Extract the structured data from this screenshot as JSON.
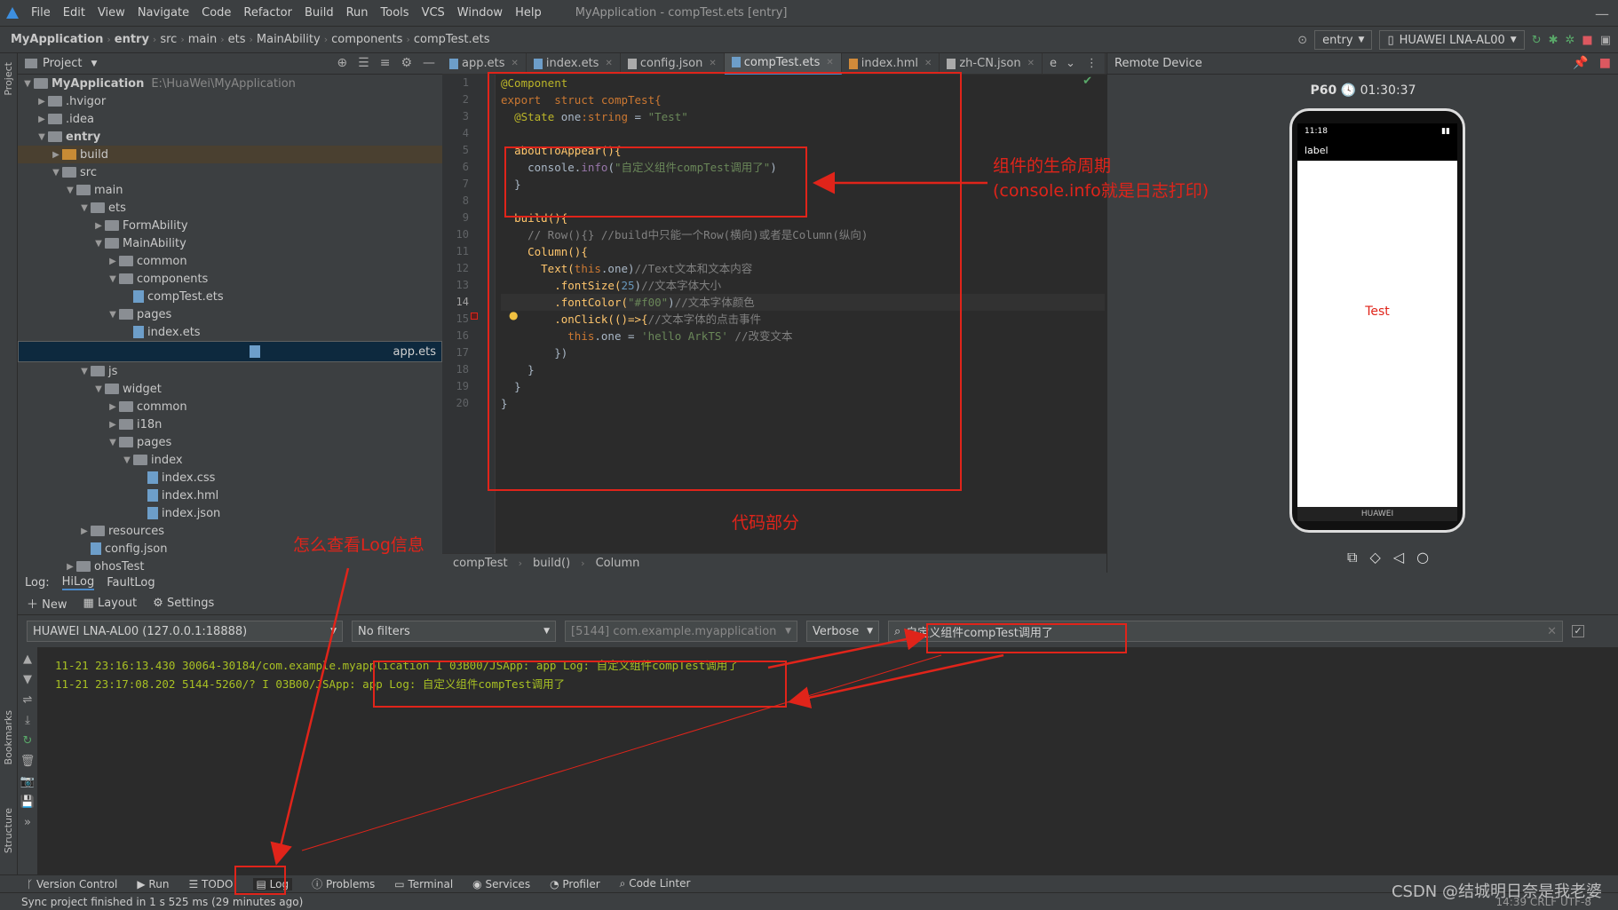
{
  "menubar": {
    "items": [
      "File",
      "Edit",
      "View",
      "Navigate",
      "Code",
      "Refactor",
      "Build",
      "Run",
      "Tools",
      "VCS",
      "Window",
      "Help"
    ],
    "title": "MyApplication - compTest.ets [entry]"
  },
  "navbar": {
    "crumbs": [
      "MyApplication",
      "entry",
      "src",
      "main",
      "ets",
      "MainAbility",
      "components",
      "compTest.ets"
    ],
    "module_combo": "entry",
    "device_combo": "HUAWEI LNA-AL00"
  },
  "project": {
    "header": "Project",
    "root_name": "MyApplication",
    "root_path": "E:\\HuaWei\\MyApplication",
    "tree": [
      {
        "label": ".hvigor",
        "d": 1
      },
      {
        "label": ".idea",
        "d": 1
      },
      {
        "label": "entry",
        "d": 1
      },
      {
        "label": "build",
        "d": 2
      },
      {
        "label": "src",
        "d": 2
      },
      {
        "label": "main",
        "d": 3
      },
      {
        "label": "ets",
        "d": 4
      },
      {
        "label": "FormAbility",
        "d": 5
      },
      {
        "label": "MainAbility",
        "d": 5
      },
      {
        "label": "common",
        "d": 6
      },
      {
        "label": "components",
        "d": 6
      },
      {
        "label": "compTest.ets",
        "d": 7
      },
      {
        "label": "pages",
        "d": 6
      },
      {
        "label": "index.ets",
        "d": 7
      },
      {
        "label": "app.ets",
        "d": 6
      },
      {
        "label": "js",
        "d": 4
      },
      {
        "label": "widget",
        "d": 5
      },
      {
        "label": "common",
        "d": 6
      },
      {
        "label": "i18n",
        "d": 6
      },
      {
        "label": "pages",
        "d": 6
      },
      {
        "label": "index",
        "d": 7
      },
      {
        "label": "index.css",
        "d": 8
      },
      {
        "label": "index.hml",
        "d": 8
      },
      {
        "label": "index.json",
        "d": 8
      },
      {
        "label": "resources",
        "d": 4
      },
      {
        "label": "config.json",
        "d": 4
      },
      {
        "label": "ohosTest",
        "d": 3
      }
    ]
  },
  "editor": {
    "tabs": [
      "app.ets",
      "index.ets",
      "config.json",
      "compTest.ets",
      "index.hml",
      "zh-CN.json",
      "e"
    ],
    "active_tab": "compTest.ets",
    "line_numbers": [
      "1",
      "2",
      "3",
      "4",
      "5",
      "6",
      "7",
      "8",
      "9",
      "10",
      "11",
      "12",
      "13",
      "14",
      "15",
      "16",
      "17",
      "18",
      "19",
      "20"
    ],
    "code": {
      "l1": "@Component",
      "l2a": "export",
      "l2b": "struct",
      "l2c": "compTest{",
      "l3a": "@State",
      "l3b": "one",
      "l3c": ":string",
      "l3d": " = ",
      "l3e": "\"Test\"",
      "l5": "aboutToAppear(){",
      "l6a": "console.",
      "l6b": "info",
      "l6c": "(",
      "l6d": "\"自定义组件compTest调用了\"",
      "l6e": ")",
      "l7": "}",
      "l9": "build(){",
      "l10": "// Row(){} //build中只能一个Row(横向)或者是Column(纵向)",
      "l11": "Column(){",
      "l12a": "Text(",
      "l12b": "this",
      "l12c": ".one)",
      "l12d": "//Text文本和文本内容",
      "l13a": ".fontSize(",
      "l13b": "25",
      "l13c": ")",
      "l13d": "//文本字体大小",
      "l14a": ".fontColor(",
      "l14b": "\"#f00\"",
      "l14c": ")",
      "l14d": "//文本字体颜色",
      "l15a": ".onClick(()=>{",
      "l15b": "//文本字体的点击事件",
      "l16a": "this",
      "l16b": ".one = ",
      "l16c": "'hello ArkTS'",
      "l16d": " //改变文本",
      "l17": "})",
      "l18": "}",
      "l19": "}",
      "l20": "}"
    },
    "footer": [
      "compTest",
      "build()",
      "Column"
    ]
  },
  "remote": {
    "title": "Remote Device",
    "device_name": "P60",
    "time": "01:30:37",
    "status_time": "11:18",
    "app_label": "label",
    "screen_text": "Test",
    "brand": "HUAWEI",
    "text_color": "#e0241a"
  },
  "log": {
    "label": "Log:",
    "tabs": [
      "HiLog",
      "FaultLog"
    ],
    "tools": [
      "New",
      "Layout",
      "Settings"
    ],
    "device_select": "HUAWEI LNA-AL00 (127.0.0.1:18888)",
    "filter_select": "No filters",
    "process_select": "[5144] com.example.myapplication",
    "level_select": "Verbose",
    "search_value": "自定义组件compTest调用了",
    "lines": [
      "11-21 23:16:13.430 30064-30184/com.example.myapplication I 03B00/JSApp: app Log: 自定义组件compTest调用了",
      "11-21 23:17:08.202 5144-5260/? I 03B00/JSApp: app Log: 自定义组件compTest调用了"
    ],
    "side_labels": [
      "Bookmarks",
      "Structure"
    ]
  },
  "bottombar": {
    "items": [
      "Version Control",
      "Run",
      "TODO",
      "Log",
      "Problems",
      "Terminal",
      "Services",
      "Profiler",
      "Code Linter"
    ]
  },
  "statusbar": {
    "text": "Sync project finished in 1 s 525 ms (29 minutes ago)",
    "right": "14:39  CRLF  UTF-8"
  },
  "annotations": {
    "lifecycle1": "组件的生命周期",
    "lifecycle2": "(console.info就是日志打印)",
    "code_part": "代码部分",
    "howto_log": "怎么查看Log信息",
    "watermark": "CSDN @结城明日奈是我老婆"
  }
}
